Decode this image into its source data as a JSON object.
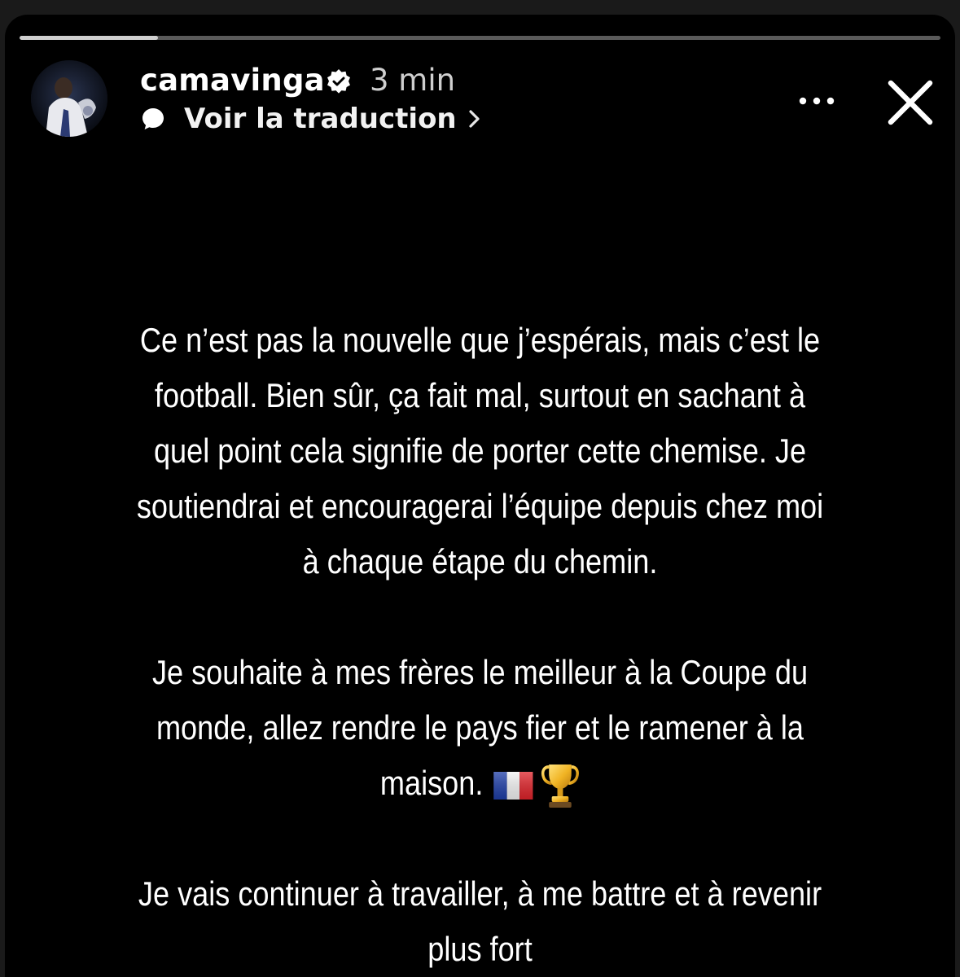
{
  "story": {
    "progress_fraction": 0.15,
    "username": "camavinga",
    "verified": true,
    "time": "3 min",
    "translate_label": "Voir la traduction",
    "icons": {
      "verified": "verified-badge-icon",
      "bubble": "speech-bubble-icon",
      "chevron": "chevron-right-icon",
      "more": "more-options-icon",
      "close": "close-icon"
    }
  },
  "message": {
    "paragraph_1": [
      "Ce n’est pas la nouvelle que j’espérais, mais c’est le",
      "football. Bien sûr, ça fait mal, surtout en sachant à",
      "quel point cela signifie de porter cette chemise. Je",
      "soutiendrai et encouragerai l’équipe depuis chez moi",
      "à chaque étape du chemin."
    ],
    "paragraph_2": [
      "Je souhaite à mes frères le meilleur à la Coupe du",
      "monde, allez rendre le pays fier et le ramener à la",
      "maison."
    ],
    "paragraph_2_emojis": [
      "french-flag-emoji",
      "trophy-emoji"
    ],
    "paragraph_3": [
      "Je vais continuer à travailler, à me battre et à revenir",
      "plus fort"
    ]
  },
  "colors": {
    "background": "#000000",
    "text": "#ffffff",
    "muted": "#cfcfcf",
    "progress_track": "#5a5a5a"
  }
}
